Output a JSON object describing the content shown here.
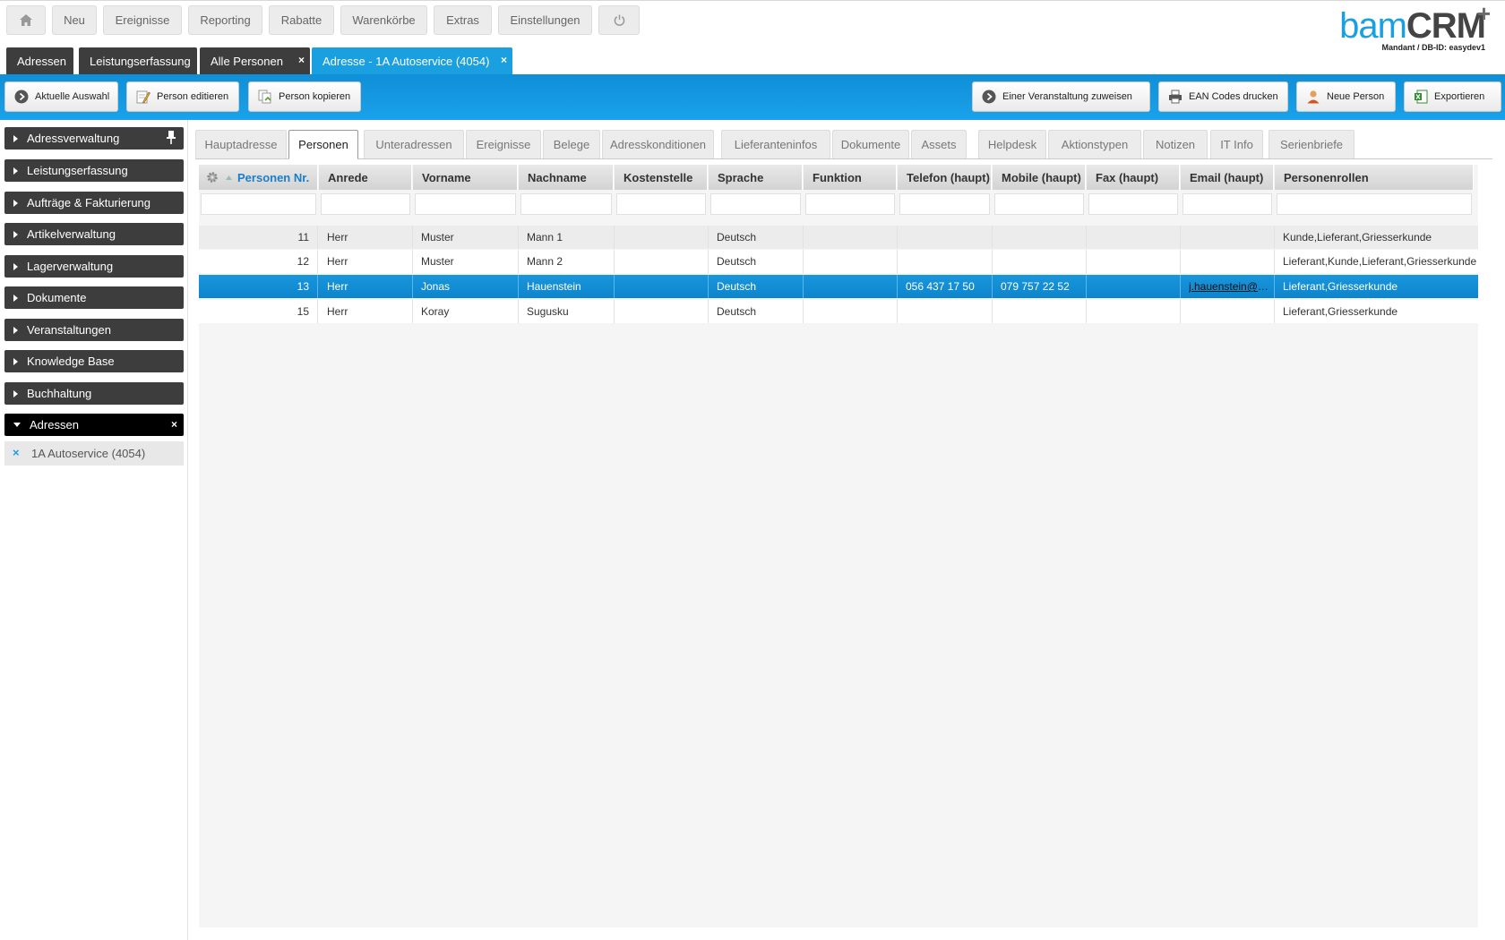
{
  "topnav": {
    "home_icon": "home-icon",
    "items": [
      "Neu",
      "Ereignisse",
      "Reporting",
      "Rabatte",
      "Warenkörbe",
      "Extras",
      "Einstellungen"
    ],
    "power_icon": "power-icon"
  },
  "logo": {
    "part1": "bam",
    "part2": "CRM",
    "plus": "+",
    "mandant": "Mandant / DB-ID: easydev1"
  },
  "doctabs": [
    {
      "label": "Adressen",
      "closable": false,
      "active": false
    },
    {
      "label": "Leistungserfassung",
      "closable": false,
      "active": false
    },
    {
      "label": "Alle Personen",
      "closable": true,
      "active": false
    },
    {
      "label": "Adresse - 1A Autoservice (4054)",
      "closable": true,
      "active": true
    }
  ],
  "close_glyph": "×",
  "toolbar": {
    "left": [
      {
        "label": "Aktuelle Auswahl",
        "icon": "arrow-circle-icon"
      },
      {
        "label": "Person editieren",
        "icon": "edit-icon"
      },
      {
        "label": "Person kopieren",
        "icon": "copy-icon"
      }
    ],
    "right": [
      {
        "label": "Einer Veranstaltung zuweisen",
        "icon": "arrow-circle-icon"
      },
      {
        "label": "EAN Codes drucken",
        "icon": "printer-icon"
      },
      {
        "label": "Neue Person",
        "icon": "person-icon"
      },
      {
        "label": "Exportieren",
        "icon": "excel-icon"
      }
    ]
  },
  "sidebar": {
    "items": [
      "Adressverwaltung",
      "Leistungserfassung",
      "Aufträge & Fakturierung",
      "Artikelverwaltung",
      "Lagerverwaltung",
      "Dokumente",
      "Veranstaltungen",
      "Knowledge Base",
      "Buchhaltung",
      "Adressen"
    ],
    "sub_item": "1A Autoservice (4054)"
  },
  "subtabs": {
    "items": [
      "Hauptadresse",
      "Personen",
      "Unteradressen",
      "Ereignisse",
      "Belege",
      "Adresskonditionen",
      "Lieferanteninfos",
      "Dokumente",
      "Assets",
      "Helpdesk",
      "Aktionstypen",
      "Notizen",
      "IT Info",
      "Serienbriefe"
    ],
    "active": "Personen"
  },
  "grid": {
    "columns": [
      "Personen Nr.",
      "Anrede",
      "Vorname",
      "Nachname",
      "Kostenstelle",
      "Sprache",
      "Funktion",
      "Telefon (haupt)",
      "Mobile (haupt)",
      "Fax (haupt)",
      "Email (haupt)",
      "Personenrollen"
    ],
    "sort_column": "Personen Nr.",
    "rows": [
      [
        "11",
        "Herr",
        "Muster",
        "Mann 1",
        "",
        "Deutsch",
        "",
        "",
        "",
        "",
        "",
        "Kunde,Lieferant,Griesserkunde"
      ],
      [
        "12",
        "Herr",
        "Muster",
        "Mann 2",
        "",
        "Deutsch",
        "",
        "",
        "",
        "",
        "",
        "Lieferant,Kunde,Lieferant,Griesserkunde"
      ],
      [
        "13",
        "Herr",
        "Jonas",
        "Hauenstein",
        "",
        "Deutsch",
        "",
        "056 437 17 50",
        "079 757 22 52",
        "",
        "j.hauenstein@bam.ch",
        "Lieferant,Griesserkunde"
      ],
      [
        "15",
        "Herr",
        "Koray",
        "Sugusku",
        "",
        "Deutsch",
        "",
        "",
        "",
        "",
        "",
        "Lieferant,Griesserkunde"
      ]
    ],
    "selected_row": 2
  },
  "colors": {
    "accent": "#1a9fe0",
    "dark": "#3d3d3d"
  }
}
